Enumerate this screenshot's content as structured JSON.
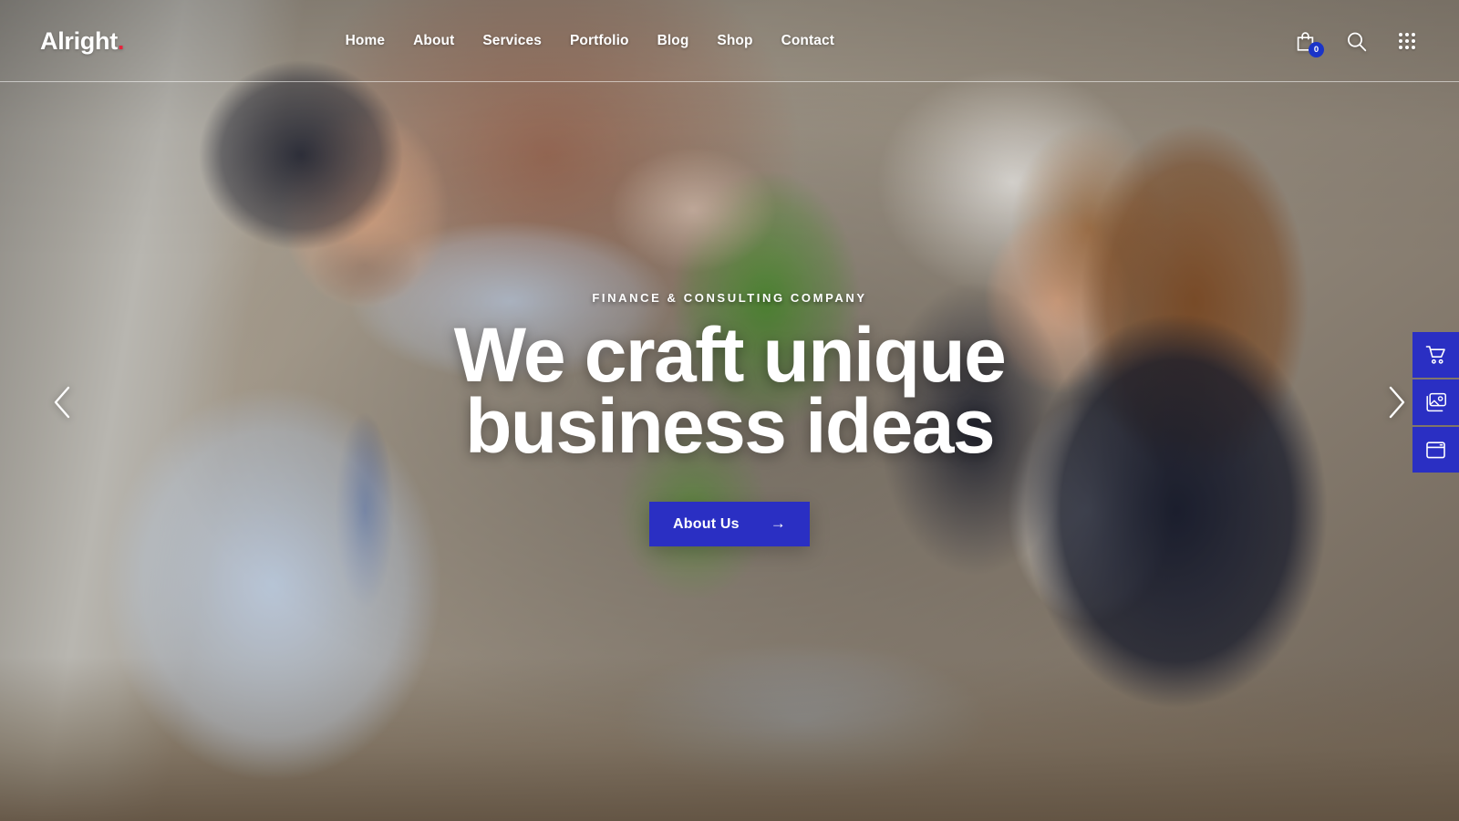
{
  "brand": {
    "name": "Alright",
    "dot": ".",
    "dot_color": "#e8243c"
  },
  "nav": {
    "items": [
      {
        "label": "Home"
      },
      {
        "label": "About"
      },
      {
        "label": "Services"
      },
      {
        "label": "Portfolio"
      },
      {
        "label": "Blog"
      },
      {
        "label": "Shop"
      },
      {
        "label": "Contact"
      }
    ]
  },
  "header_tools": {
    "cart": {
      "icon": "shopping-bag-icon",
      "badge": "0",
      "badge_color": "#1a34c8"
    },
    "search": {
      "icon": "search-icon"
    },
    "apps": {
      "icon": "grid-dots-icon"
    }
  },
  "hero": {
    "eyebrow": "Finance & Consulting Company",
    "headline_line1": "We craft unique",
    "headline_line2": "business ideas",
    "cta_label": "About Us",
    "cta_arrow": "→",
    "cta_color": "#2a2fc3"
  },
  "carousel": {
    "prev_label": "Previous slide",
    "next_label": "Next slide"
  },
  "side_dock": {
    "buttons": [
      {
        "icon": "shopping-cart-icon",
        "label": "Cart"
      },
      {
        "icon": "image-gallery-icon",
        "label": "Gallery"
      },
      {
        "icon": "browser-window-icon",
        "label": "Layouts"
      }
    ],
    "color": "#2a2fc3"
  }
}
